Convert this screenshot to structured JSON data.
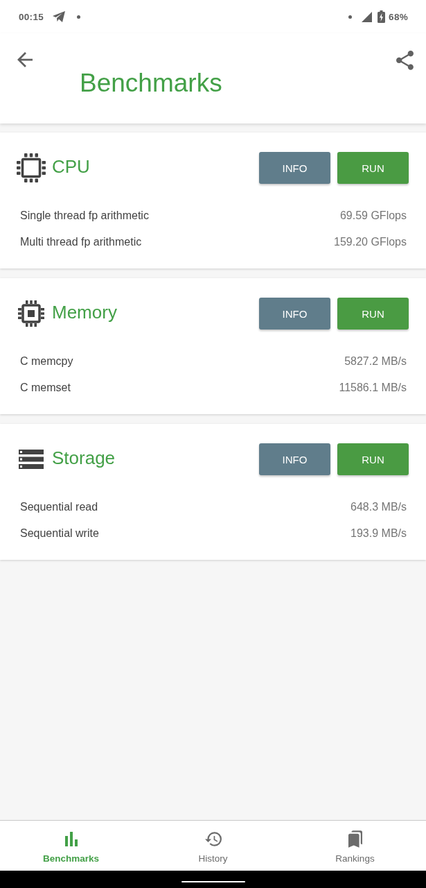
{
  "status_bar": {
    "time": "00:15",
    "battery": "68%"
  },
  "app_bar": {
    "title": "Benchmarks"
  },
  "sections": [
    {
      "kind": "cpu",
      "title": "CPU",
      "buttons": [
        {
          "kind": "info",
          "label": "INFO"
        },
        {
          "kind": "run",
          "label": "RUN"
        }
      ],
      "results": [
        {
          "label": "Single thread fp arithmetic",
          "value": "69.59 GFlops"
        },
        {
          "label": "Multi thread fp arithmetic",
          "value": "159.20 GFlops"
        }
      ]
    },
    {
      "kind": "memory",
      "title": "Memory",
      "buttons": [
        {
          "kind": "info",
          "label": "INFO"
        },
        {
          "kind": "run",
          "label": "RUN"
        }
      ],
      "results": [
        {
          "label": "C memcpy",
          "value": "5827.2 MB/s"
        },
        {
          "label": "C memset",
          "value": "11586.1 MB/s"
        }
      ]
    },
    {
      "kind": "storage",
      "title": "Storage",
      "buttons": [
        {
          "kind": "info",
          "label": "INFO"
        },
        {
          "kind": "run",
          "label": "RUN"
        }
      ],
      "results": [
        {
          "label": "Sequential read",
          "value": "648.3 MB/s"
        },
        {
          "label": "Sequential write",
          "value": "193.9 MB/s"
        }
      ]
    }
  ],
  "bottom_nav": [
    {
      "kind": "benchmarks",
      "label": "Benchmarks",
      "selected": true
    },
    {
      "kind": "history",
      "label": "History",
      "selected": false
    },
    {
      "kind": "rankings",
      "label": "Rankings",
      "selected": false
    }
  ]
}
